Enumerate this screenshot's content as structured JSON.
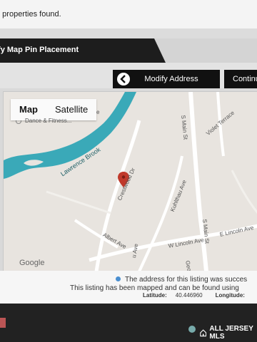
{
  "topbar": {
    "message": "o properties found."
  },
  "title": "ify Map Pin Placement",
  "buttons": {
    "modify": "Modify Address",
    "continue": "Continu"
  },
  "map": {
    "types": [
      "Map",
      "Satellite"
    ],
    "labels": {
      "poi": "Dance & Fitness...",
      "brook": "Lawrence Brook",
      "crestwood": "Crestwood Dr",
      "kuhlthau": "Kuhlthau Ave",
      "main_n": "S Main St",
      "violet": "Violet Terrace",
      "main_s": "S Main St",
      "lincoln_w": "W Lincoln Ave",
      "lincoln_e": "E Lincoln Ave",
      "albert": "Albert Ave",
      "ave_small": "u Ave",
      "george": "George",
      "e_short": "e"
    },
    "attribution": "Google"
  },
  "info": {
    "line1": "The address for this listing was succes",
    "line2": "This listing has been mapped and can be found using",
    "latitude_label": "Latitude:",
    "latitude_value": "40.446960",
    "longitude_label": "Longitude:"
  },
  "footer": {
    "brand": "ALL JERSEY MLS"
  },
  "colors": {
    "water": "#3aa9b8",
    "road": "#ffffff",
    "pin": "#c0392b",
    "dark": "#111111"
  }
}
